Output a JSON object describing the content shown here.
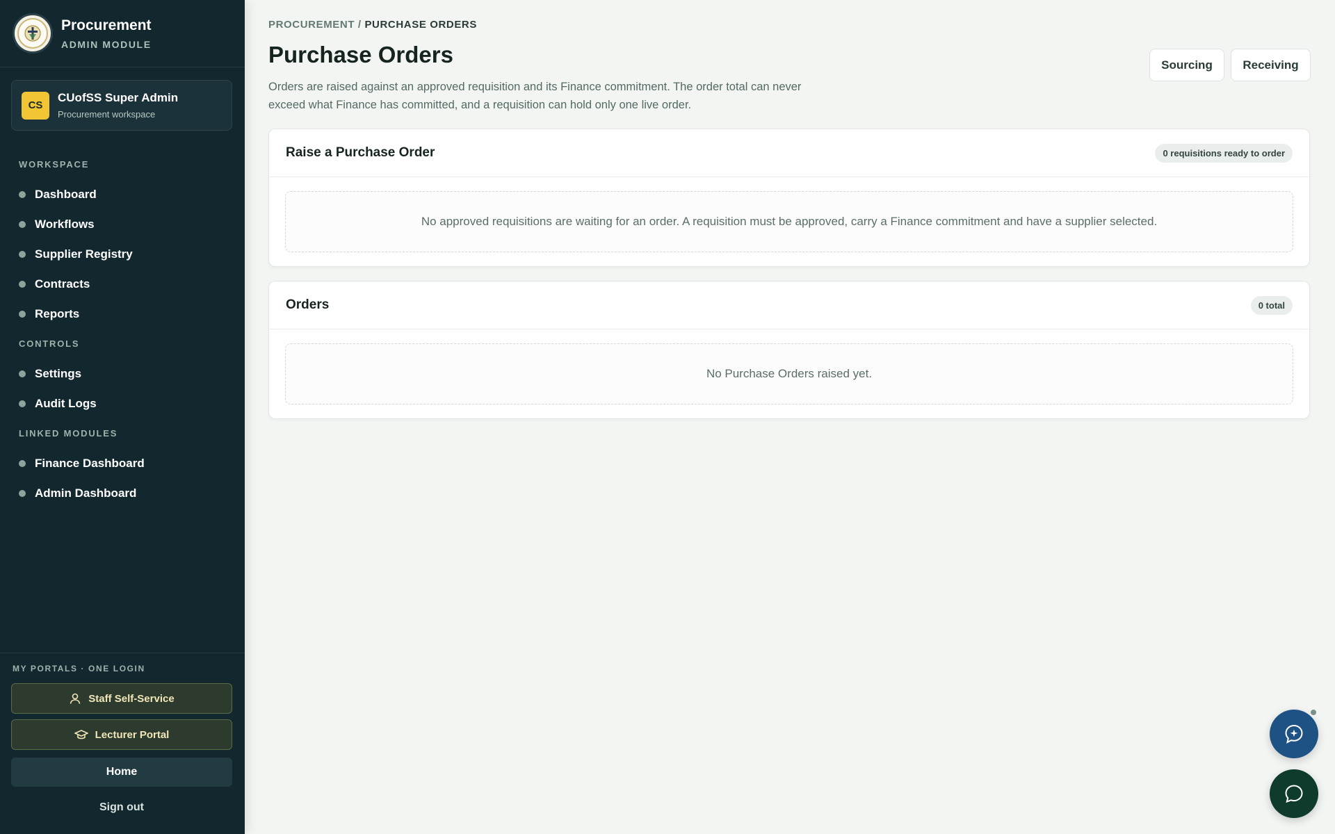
{
  "sidebar": {
    "brand": {
      "title": "Procurement",
      "subtitle": "ADMIN MODULE"
    },
    "user": {
      "initials": "CS",
      "name": "CUofSS Super Admin",
      "workspace": "Procurement workspace"
    },
    "sections": {
      "workspace": "WORKSPACE",
      "controls": "CONTROLS",
      "linked": "LINKED MODULES"
    },
    "items": {
      "dashboard": "Dashboard",
      "workflows": "Workflows",
      "supplier_registry": "Supplier Registry",
      "contracts": "Contracts",
      "reports": "Reports",
      "settings": "Settings",
      "audit_logs": "Audit Logs",
      "finance_dashboard": "Finance Dashboard",
      "admin_dashboard": "Admin Dashboard"
    },
    "portals": {
      "title": "MY PORTALS · ONE LOGIN",
      "staff": "Staff Self-Service",
      "lecturer": "Lecturer Portal",
      "home": "Home",
      "signout": "Sign out"
    }
  },
  "main": {
    "breadcrumb": {
      "parent": "PROCUREMENT",
      "separator": "/",
      "current": "PURCHASE ORDERS"
    },
    "title": "Purchase Orders",
    "description": "Orders are raised against an approved requisition and its Finance commitment. The order total can never exceed what Finance has committed, and a requisition can hold only one live order.",
    "actions": {
      "sourcing": "Sourcing",
      "receiving": "Receiving"
    },
    "raise_card": {
      "title": "Raise a Purchase Order",
      "badge": "0 requisitions ready to order",
      "empty": "No approved requisitions are waiting for an order. A requisition must be approved, carry a Finance commitment and have a supplier selected."
    },
    "orders_card": {
      "title": "Orders",
      "badge": "0 total",
      "empty": "No Purchase Orders raised yet."
    }
  },
  "colors": {
    "sidebar_bg": "#13272f",
    "accent_yellow": "#f2c535",
    "fab_blue": "#1f5284",
    "fab_green": "#0e3b2c"
  },
  "icons": {
    "brand_logo": "crest-logo",
    "staff_portal": "person-icon",
    "lecturer_portal": "graduation-cap-icon",
    "assistant_fab": "ai-chat-icon",
    "chat_fab": "chat-bubble-icon"
  }
}
